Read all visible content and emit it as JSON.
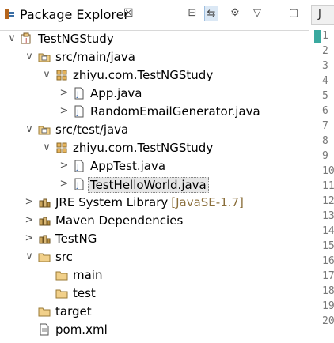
{
  "view": {
    "title": "Package Explorer",
    "close_glyph": "☒"
  },
  "toolbar": [
    {
      "name": "collapse-all-icon",
      "glyph": "⊟"
    },
    {
      "name": "link-with-editor-icon",
      "glyph": "⇆"
    },
    {
      "name": "focus-icon",
      "glyph": "⚙"
    },
    {
      "name": "view-menu-icon",
      "glyph": "▽"
    },
    {
      "name": "minimize-icon",
      "glyph": "—"
    },
    {
      "name": "maximize-icon",
      "glyph": "▢"
    }
  ],
  "tree": [
    {
      "label": "TestNGStudy",
      "icon": "project-icon",
      "depth": 0,
      "twisty": "open"
    },
    {
      "label": "src/main/java",
      "icon": "source-folder-icon",
      "depth": 1,
      "twisty": "open"
    },
    {
      "label": "zhiyu.com.TestNGStudy",
      "icon": "package-icon",
      "depth": 2,
      "twisty": "open"
    },
    {
      "label": "App.java",
      "icon": "java-file-icon",
      "depth": 3,
      "twisty": "closed"
    },
    {
      "label": "RandomEmailGenerator.java",
      "icon": "java-file-icon",
      "depth": 3,
      "twisty": "closed"
    },
    {
      "label": "src/test/java",
      "icon": "source-folder-icon",
      "depth": 1,
      "twisty": "open"
    },
    {
      "label": "zhiyu.com.TestNGStudy",
      "icon": "package-icon",
      "depth": 2,
      "twisty": "open"
    },
    {
      "label": "AppTest.java",
      "icon": "java-file-icon",
      "depth": 3,
      "twisty": "closed"
    },
    {
      "label": "TestHelloWorld.java",
      "icon": "java-file-icon",
      "depth": 3,
      "twisty": "closed",
      "selected": true
    },
    {
      "label": "JRE System Library",
      "decoration": "[JavaSE-1.7]",
      "icon": "library-icon",
      "depth": 1,
      "twisty": "closed"
    },
    {
      "label": "Maven Dependencies",
      "icon": "library-icon",
      "depth": 1,
      "twisty": "closed"
    },
    {
      "label": "TestNG",
      "icon": "library-icon",
      "depth": 1,
      "twisty": "closed"
    },
    {
      "label": "src",
      "icon": "folder-icon",
      "depth": 1,
      "twisty": "open"
    },
    {
      "label": "main",
      "icon": "folder-icon",
      "depth": 2,
      "twisty": "none"
    },
    {
      "label": "test",
      "icon": "folder-icon",
      "depth": 2,
      "twisty": "none"
    },
    {
      "label": "target",
      "icon": "folder-icon",
      "depth": 1,
      "twisty": "none"
    },
    {
      "label": "pom.xml",
      "icon": "xml-file-icon",
      "depth": 1,
      "twisty": "none"
    }
  ],
  "editor": {
    "tab_glyph": "J",
    "line_numbers": [
      "1",
      "2",
      "3",
      "4",
      "5",
      "6",
      "7",
      "8",
      "9",
      "10",
      "11",
      "12",
      "13",
      "14",
      "15",
      "16",
      "17",
      "18",
      "19",
      "20"
    ]
  },
  "colors": {
    "selection": "#e6e6e6",
    "decoration": "#8a6e3a",
    "twisty": "#555555"
  }
}
